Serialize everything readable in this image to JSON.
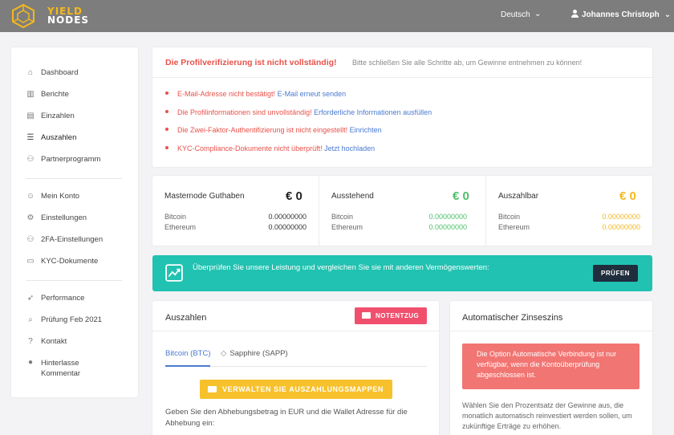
{
  "header": {
    "logo_line1": "YIELD",
    "logo_line2": "NODES",
    "language": "Deutsch",
    "user_name": "Johannes Christoph"
  },
  "sidebar": {
    "group1": [
      {
        "label": "Dashboard",
        "icon": "home-icon"
      },
      {
        "label": "Berichte",
        "icon": "chart-icon"
      },
      {
        "label": "Einzahlen",
        "icon": "briefcase-icon"
      },
      {
        "label": "Auszahlen",
        "icon": "stack-icon"
      },
      {
        "label": "Partnerprogramm",
        "icon": "users-icon"
      }
    ],
    "group2": [
      {
        "label": "Mein Konto",
        "icon": "user-icon"
      },
      {
        "label": "Einstellungen",
        "icon": "gear-icon"
      },
      {
        "label": "2FA-Einstellungen",
        "icon": "users-lock-icon"
      },
      {
        "label": "KYC-Dokumente",
        "icon": "id-card-icon"
      }
    ],
    "group3": [
      {
        "label": "Performance",
        "icon": "rocket-icon"
      },
      {
        "label": "Prüfung Feb 2021",
        "icon": "search-icon"
      },
      {
        "label": "Kontakt",
        "icon": "question-icon"
      },
      {
        "label_line1": "Hinterlasse",
        "label_line2": "Kommentar",
        "icon": "comment-icon"
      }
    ]
  },
  "verification": {
    "title": "Die Profilverifizierung ist nicht vollständig!",
    "subtitle": "Bitte schließen Sie alle Schritte ab, um Gewinne entnehmen zu können!",
    "items": [
      {
        "text": "E-Mail-Adresse nicht bestätigt!",
        "link": "E-Mail erneut senden"
      },
      {
        "text": "Die Profilinformationen sind unvollständig!",
        "link": "Erforderliche Informationen ausfüllen"
      },
      {
        "text": "Die Zwei-Faktor-Authentifizierung ist nicht eingestellt!",
        "link": "Einrichten"
      },
      {
        "text": "KYC-Compliance-Dokumente nicht überprüft!",
        "link": "Jetzt hochladen"
      }
    ]
  },
  "balances": [
    {
      "title": "Masternode Guthaben",
      "value": "€ 0",
      "color": "#222222",
      "rows": [
        {
          "label": "Bitcoin",
          "value": "0.00000000"
        },
        {
          "label": "Ethereum",
          "value": "0.00000000"
        }
      ]
    },
    {
      "title": "Ausstehend",
      "value": "€ 0",
      "color": "#4cc06a",
      "rows": [
        {
          "label": "Bitcoin",
          "value": "0.00000000"
        },
        {
          "label": "Ethereum",
          "value": "0.00000000"
        }
      ]
    },
    {
      "title": "Auszahlbar",
      "value": "€ 0",
      "color": "#f5b81c",
      "rows": [
        {
          "label": "Bitcoin",
          "value": "0.00000000"
        },
        {
          "label": "Ethereum",
          "value": "0.00000000"
        }
      ]
    }
  ],
  "banner": {
    "text": "Überprüfen Sie unsere Leistung und vergleichen Sie sie mit anderen Vermögenswerten:",
    "button": "PRÜFEN"
  },
  "withdraw": {
    "title": "Auszahlen",
    "emergency_button": "NOTENTZUG",
    "tabs": [
      "Bitcoin (BTC)",
      "Sapphire (SAPP)"
    ],
    "manage_button": "VERWALTEN SIE AUSZAHLUNGSMAPPEN",
    "instructions": "Geben Sie den Abhebungsbetrag in EUR und die Wallet Adresse für die Abhebung ein:"
  },
  "compound": {
    "title": "Automatischer Zinseszins",
    "alert": "Die Option Automatische Verbindung ist nur verfügbar, wenn die Kontoüberprüfung abgeschlossen ist.",
    "description": "Wählen Sie den Prozentsatz der Gewinne aus, die monatlich automatisch reinvestiert werden sollen, um zukünftige Erträge zu erhöhen."
  }
}
